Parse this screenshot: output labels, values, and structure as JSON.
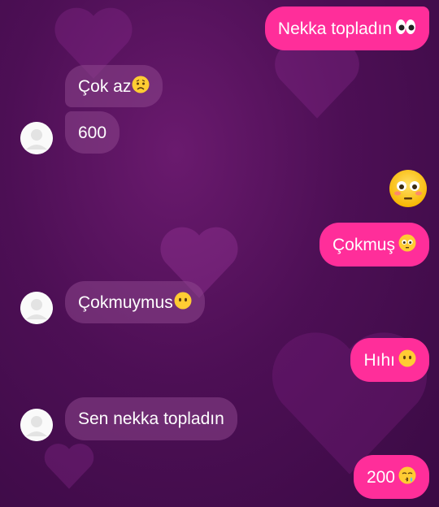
{
  "messages": [
    {
      "id": 1,
      "side": "out",
      "text": "Nekka topladın",
      "emoji": "eyes"
    },
    {
      "id": 2,
      "side": "in",
      "text": "Çok az",
      "emoji": "worried-face"
    },
    {
      "id": 3,
      "side": "in",
      "text": "600",
      "emoji": ""
    },
    {
      "id": 4,
      "side": "out",
      "text": "",
      "emoji": "flushed-face"
    },
    {
      "id": 5,
      "side": "out",
      "text": "Çokmuş",
      "emoji": "flushed-face"
    },
    {
      "id": 6,
      "side": "in",
      "text": "Çokmuymus",
      "emoji": "no-mouth-face"
    },
    {
      "id": 7,
      "side": "out",
      "text": "Hıhı",
      "emoji": "no-mouth-face"
    },
    {
      "id": 8,
      "side": "in",
      "text": "Sen nekka topladın",
      "emoji": ""
    },
    {
      "id": 9,
      "side": "out",
      "text": "200",
      "emoji": "kissing-face"
    }
  ],
  "colors": {
    "outgoing_bubble": "#ff2e9a",
    "incoming_bubble": "#8c468c",
    "background": "#4d0f55",
    "avatar": "#fafafa"
  }
}
